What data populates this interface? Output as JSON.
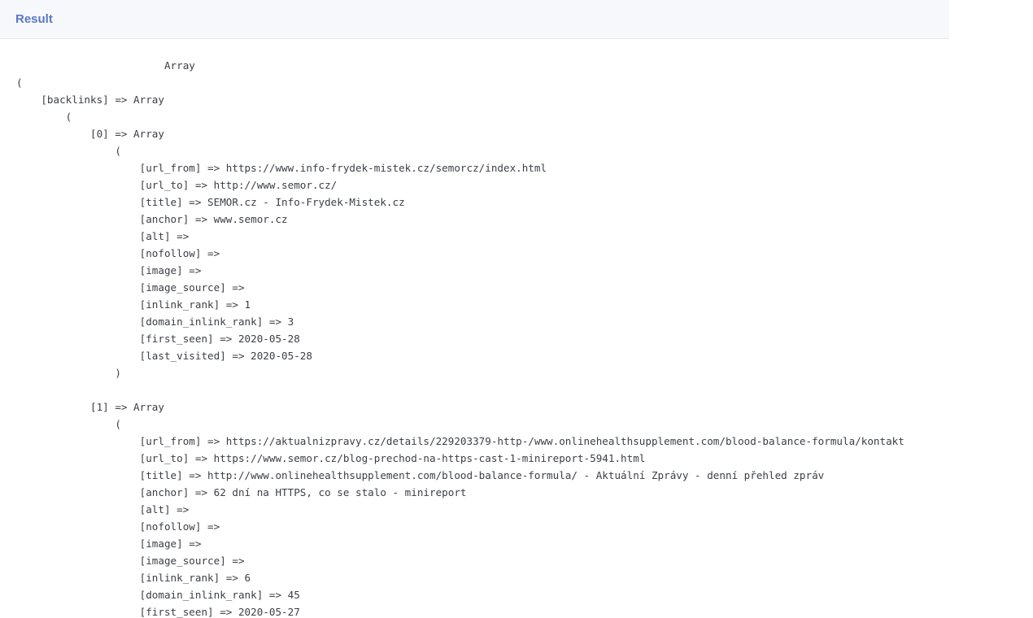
{
  "header": {
    "title": "Result"
  },
  "result": {
    "lines": [
      "                        Array",
      "(",
      "    [backlinks] => Array",
      "        (",
      "            [0] => Array",
      "                (",
      "                    [url_from] => https://www.info-frydek-mistek.cz/semorcz/index.html",
      "                    [url_to] => http://www.semor.cz/",
      "                    [title] => SEMOR.cz - Info-Frydek-Mistek.cz",
      "                    [anchor] => www.semor.cz",
      "                    [alt] =>",
      "                    [nofollow] =>",
      "                    [image] =>",
      "                    [image_source] =>",
      "                    [inlink_rank] => 1",
      "                    [domain_inlink_rank] => 3",
      "                    [first_seen] => 2020-05-28",
      "                    [last_visited] => 2020-05-28",
      "                )",
      "",
      "            [1] => Array",
      "                (",
      "                    [url_from] => https://aktualnizpravy.cz/details/229203379-http-/www.onlinehealthsupplement.com/blood-balance-formula/kontakt",
      "                    [url_to] => https://www.semor.cz/blog-prechod-na-https-cast-1-minireport-5941.html",
      "                    [title] => http://www.onlinehealthsupplement.com/blood-balance-formula/ - Aktuální Zprávy - denní přehled zpráv",
      "                    [anchor] => 62 dní na HTTPS, co se stalo - minireport",
      "                    [alt] =>",
      "                    [nofollow] =>",
      "                    [image] =>",
      "                    [image_source] =>",
      "                    [inlink_rank] => 6",
      "                    [domain_inlink_rank] => 45",
      "                    [first_seen] => 2020-05-27"
    ]
  }
}
